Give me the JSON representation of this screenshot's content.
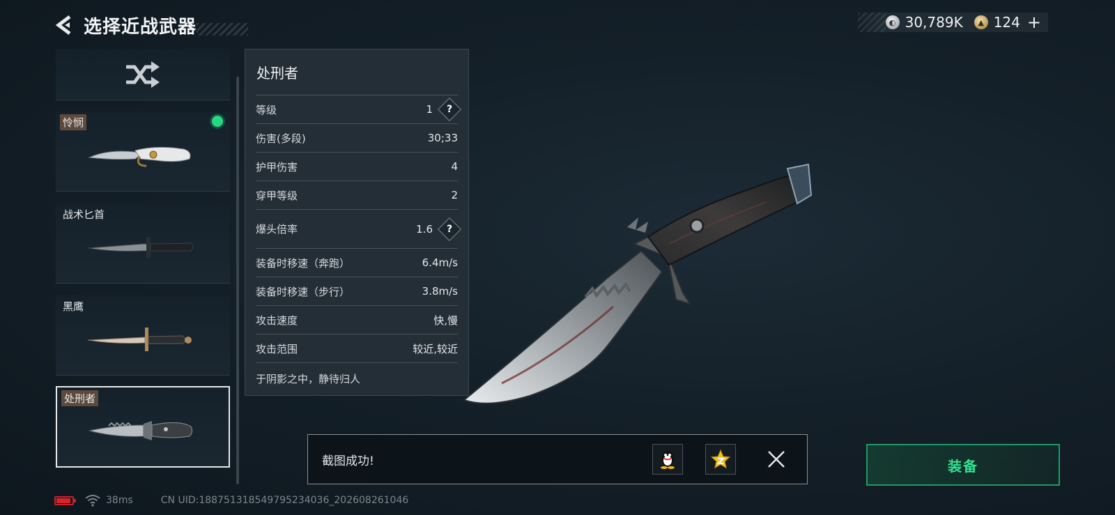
{
  "header": {
    "title": "选择近战武器"
  },
  "currency": {
    "silver": "30,789K",
    "gold": "124",
    "plus": "+"
  },
  "weapons": [
    {
      "name": "怜悯",
      "equipped": true
    },
    {
      "name": "战术匕首"
    },
    {
      "name": "黑鹰"
    },
    {
      "name": "处刑者",
      "selected": true
    }
  ],
  "stats": {
    "name": "处刑者",
    "rows": [
      {
        "label": "等级",
        "value": "1"
      },
      {
        "label": "伤害(多段)",
        "value": "30;33"
      },
      {
        "label": "护甲伤害",
        "value": "4"
      },
      {
        "label": "穿甲等级",
        "value": "2"
      },
      {
        "label": "爆头倍率",
        "value": "1.6"
      },
      {
        "label": "装备时移速（奔跑）",
        "value": "6.4m/s"
      },
      {
        "label": "装备时移速（步行）",
        "value": "3.8m/s"
      },
      {
        "label": "攻击速度",
        "value": "快,慢"
      },
      {
        "label": "攻击范围",
        "value": "较近,较近"
      }
    ],
    "quote": "于阴影之中，静待归人",
    "help_mark": "?"
  },
  "toast": {
    "message": "截图成功!"
  },
  "equip": {
    "label": "装备"
  },
  "footer": {
    "ping": "38ms",
    "uid": "CN UID:188751318549795234036_202608261046"
  },
  "colors": {
    "accent_green": "#2ee28f",
    "equipped_dot": "#25d982",
    "battery": "#d8232d"
  }
}
